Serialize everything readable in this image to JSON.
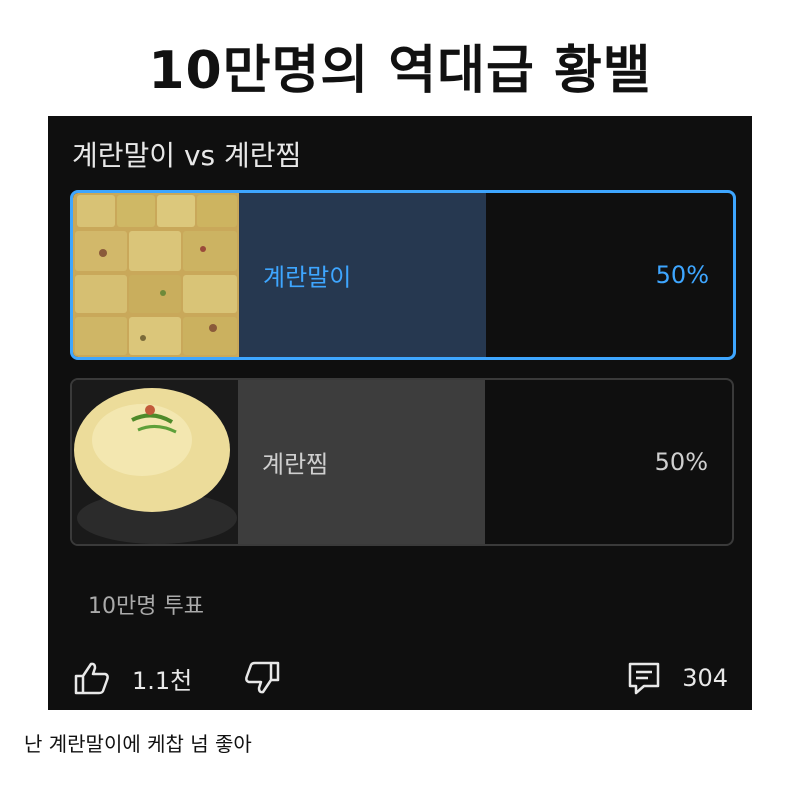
{
  "headline": "10만명의 역대급 황밸",
  "poll": {
    "question": "계란말이 vs 계란찜",
    "options": [
      {
        "label": "계란말이",
        "percent": "50%",
        "selected": true,
        "image": "rolled-omelette-photo"
      },
      {
        "label": "계란찜",
        "percent": "50%",
        "selected": false,
        "image": "steamed-egg-photo"
      }
    ],
    "vote_count": "10만명 투표"
  },
  "actions": {
    "like_count": "1.1천",
    "comment_count": "304",
    "icons": [
      "thumbs-up-icon",
      "thumbs-down-icon",
      "comment-icon"
    ]
  },
  "caption": "난 계란말이에 케찹 넘 좋아",
  "colors": {
    "accent": "#3ea6ff",
    "card_bg": "#0f0f0f",
    "selected_fill": "#263850",
    "unselected_fill": "#3d3d3d"
  }
}
